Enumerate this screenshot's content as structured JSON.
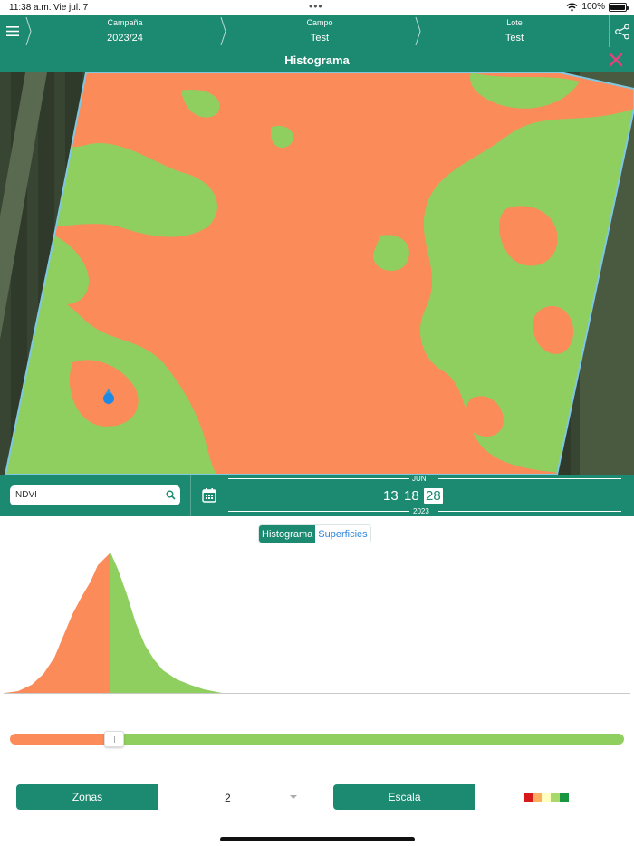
{
  "status": {
    "time": "11:38 a.m.",
    "day": "Vie jul. 7",
    "battery": "100%"
  },
  "nav": {
    "segments": [
      {
        "label": "Campaña",
        "value": "2023/24"
      },
      {
        "label": "Campo",
        "value": "Test"
      },
      {
        "label": "Lote",
        "value": "Test"
      }
    ]
  },
  "title": "Histograma",
  "icons": {
    "menu": "hamburger-icon",
    "share": "share-icon",
    "close": "close-icon",
    "search": "search-icon",
    "calendar": "calendar-icon",
    "location": "location-pin-icon"
  },
  "colors": {
    "primary": "#1c8a70",
    "low": "#fb8c5a",
    "high": "#8fcf5f",
    "close": "#e0457b"
  },
  "index_input": {
    "value": "NDVI"
  },
  "date_picker": {
    "month": "JUN",
    "year": "2023",
    "days": [
      "13",
      "18",
      "28"
    ],
    "selected": "28"
  },
  "tabs": {
    "active": "Histograma",
    "inactive": "Superficies"
  },
  "histogram": {
    "split_fraction": 0.17
  },
  "controls": {
    "zones_label": "Zonas",
    "zones_count": "2",
    "scale_label": "Escala"
  },
  "scale_colors": [
    "#d7191c",
    "#fdae61",
    "#ffffbf",
    "#a6d96a",
    "#1a9641"
  ]
}
